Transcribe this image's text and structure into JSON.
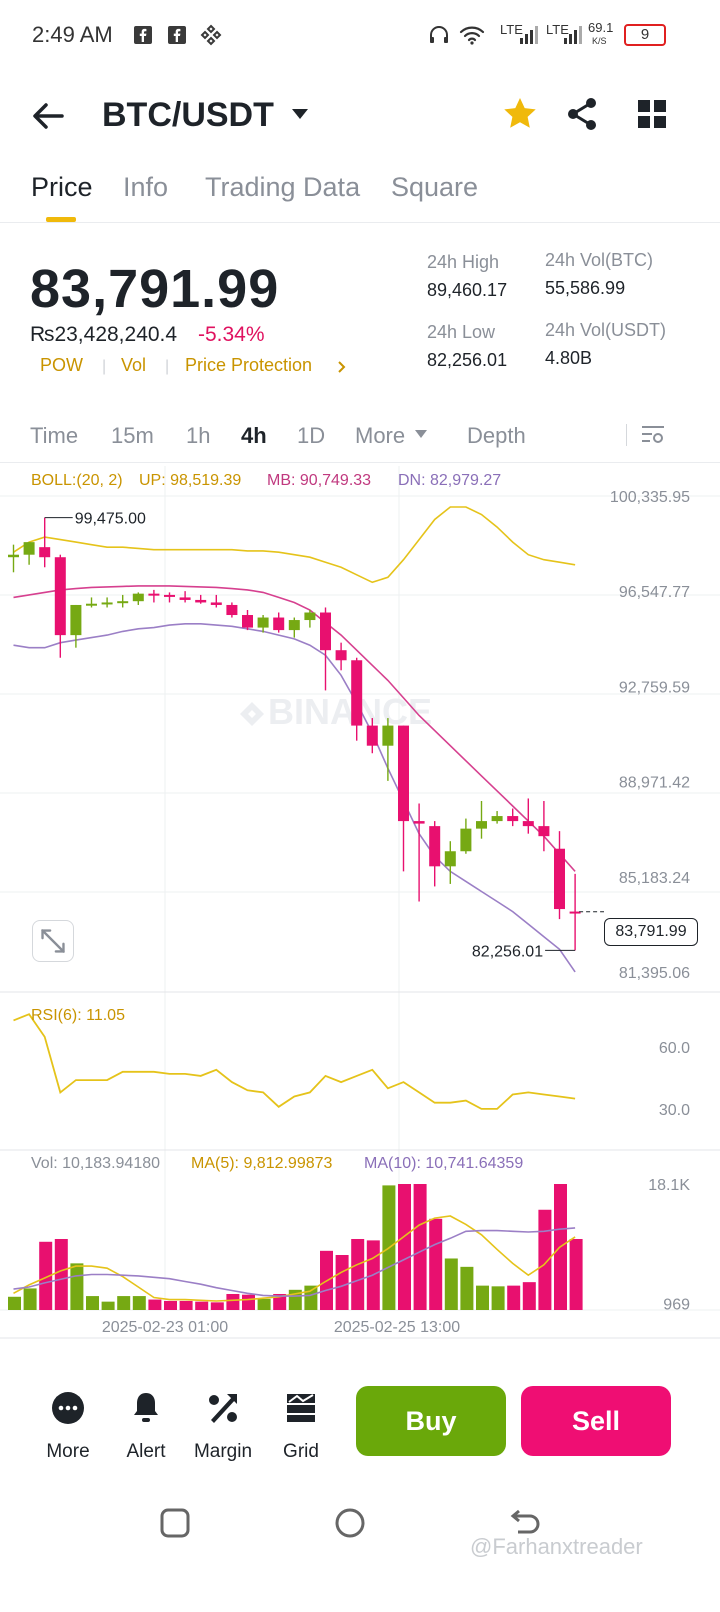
{
  "status_bar": {
    "time": "2:49 AM",
    "net_speed": "69.1",
    "net_unit": "K/S",
    "lte1": "LTE",
    "lte2": "LTE",
    "battery": "9"
  },
  "header": {
    "title": "BTC/USDT",
    "icons": [
      "back-arrow-icon",
      "dropdown-caret-icon",
      "star-icon",
      "share-icon",
      "grid-icon"
    ],
    "star_color": "#f0b90b"
  },
  "tabs": [
    "Price",
    "Info",
    "Trading Data",
    "Square"
  ],
  "active_tab": "Price",
  "ticker": {
    "last_price": "83,791.99",
    "fiat_price": "₨23,428,240.4",
    "change_pct": "-5.34%",
    "tags": [
      "POW",
      "Vol",
      "Price Protection"
    ],
    "high_label": "24h High",
    "high_value": "89,460.17",
    "low_label": "24h Low",
    "low_value": "82,256.01",
    "vol_btc_label": "24h Vol(BTC)",
    "vol_btc_value": "55,586.99",
    "vol_usdt_label": "24h Vol(USDT)",
    "vol_usdt_value": "4.80B"
  },
  "intervals": [
    "Time",
    "15m",
    "1h",
    "4h",
    "1D",
    "More",
    "Depth"
  ],
  "active_interval": "4h",
  "colors": {
    "up": "#76a913",
    "down": "#e8106f",
    "boll_up": "#e5c31a",
    "boll_mb": "#d6408f",
    "boll_dn": "#9b7fc6",
    "accent": "#f0b90b",
    "pos": "#6aa80a",
    "neg": "#ef0e73"
  },
  "chart_data": {
    "type": "candlestick",
    "boll_legend": {
      "name": "BOLL:(20, 2)",
      "up": "UP: 98,519.39",
      "mb": "MB: 90,749.33",
      "dn": "DN: 82,979.27"
    },
    "y_ticks": [
      "100,335.95",
      "96,547.77",
      "92,759.59",
      "88,971.42",
      "85,183.24",
      "81,395.06"
    ],
    "y_tick_values": [
      100335.95,
      96547.77,
      92759.59,
      88971.42,
      85183.24,
      81395.06
    ],
    "high_annotation": "99,475.00",
    "low_annotation": "82,256.01",
    "current_price_tag": "83,791.99",
    "x_ticks": [
      "2025-02-23 01:00",
      "2025-02-25 13:00"
    ],
    "watermark": "BINANCE",
    "candles": [
      [
        97900,
        98400,
        97300,
        98000
      ],
      [
        98000,
        98500,
        97600,
        98500
      ],
      [
        98300,
        99475,
        97500,
        97900
      ],
      [
        97900,
        98000,
        93900,
        94800
      ],
      [
        94800,
        96000,
        94300,
        96000
      ],
      [
        96000,
        96300,
        95900,
        96050
      ],
      [
        96050,
        96300,
        95900,
        96100
      ],
      [
        96100,
        96400,
        95900,
        96150
      ],
      [
        96150,
        96500,
        96000,
        96450
      ],
      [
        96450,
        96600,
        96100,
        96400
      ],
      [
        96400,
        96500,
        96100,
        96350
      ],
      [
        96300,
        96550,
        96100,
        96200
      ],
      [
        96200,
        96400,
        96050,
        96100
      ],
      [
        96100,
        96400,
        95900,
        96000
      ],
      [
        96000,
        96100,
        95500,
        95600
      ],
      [
        95600,
        95800,
        95000,
        95100
      ],
      [
        95100,
        95600,
        94900,
        95500
      ],
      [
        95500,
        95700,
        94900,
        95000
      ],
      [
        95000,
        95500,
        94700,
        95400
      ],
      [
        95400,
        95800,
        95100,
        95700
      ],
      [
        95700,
        95900,
        92600,
        94200
      ],
      [
        94200,
        94500,
        93400,
        93800
      ],
      [
        93800,
        93900,
        90600,
        91200
      ],
      [
        91200,
        91500,
        90100,
        90400
      ],
      [
        90400,
        91500,
        89000,
        91200
      ],
      [
        91200,
        91200,
        85400,
        87400
      ],
      [
        87400,
        88100,
        84200,
        87300
      ],
      [
        87200,
        87400,
        84800,
        85600
      ],
      [
        85600,
        86600,
        84900,
        86200
      ],
      [
        86200,
        87500,
        86100,
        87100
      ],
      [
        87100,
        88200,
        86700,
        87400
      ],
      [
        87400,
        87800,
        87300,
        87600
      ],
      [
        87600,
        87900,
        87200,
        87400
      ],
      [
        87400,
        88300,
        86900,
        87200
      ],
      [
        87200,
        88200,
        86200,
        86800
      ],
      [
        86300,
        87000,
        83500,
        83900
      ],
      [
        83800,
        85300,
        82256,
        83792
      ]
    ],
    "boll_up": [
      98100,
      98500,
      98700,
      98600,
      98500,
      98400,
      98300,
      98300,
      98250,
      98200,
      98200,
      98200,
      98200,
      98200,
      98200,
      98150,
      98150,
      98100,
      98000,
      97900,
      97700,
      97500,
      97200,
      96900,
      97100,
      97800,
      98600,
      99400,
      99900,
      99900,
      99600,
      99100,
      98500,
      98000,
      97800,
      97700,
      97600
    ],
    "boll_mb": [
      96300,
      96400,
      96500,
      96600,
      96650,
      96700,
      96720,
      96740,
      96760,
      96760,
      96760,
      96740,
      96720,
      96700,
      96650,
      96600,
      96500,
      96300,
      96100,
      95800,
      95300,
      94800,
      94200,
      93600,
      93000,
      92300,
      91600,
      91000,
      90400,
      89800,
      89200,
      88600,
      88000,
      87400,
      86800,
      86100,
      85400
    ],
    "boll_dn": [
      94400,
      94300,
      94300,
      94500,
      94600,
      94700,
      94800,
      94950,
      95050,
      95100,
      95200,
      95250,
      95250,
      95200,
      95150,
      95050,
      94950,
      94800,
      94650,
      94400,
      94000,
      93200,
      92100,
      90900,
      89500,
      88200,
      86900,
      86000,
      85400,
      85000,
      84600,
      84200,
      83800,
      83300,
      82800,
      82300,
      81400
    ]
  },
  "rsi": {
    "legend": "RSI(6): 11.05",
    "y_ticks": [
      "60.0",
      "30.0"
    ],
    "y_tick_values": [
      60,
      30
    ],
    "values": [
      73,
      76,
      65,
      38,
      44,
      44,
      44,
      48,
      48,
      48,
      47,
      47,
      46,
      49,
      43,
      39,
      38,
      31,
      36,
      38,
      46,
      43,
      46,
      49,
      40,
      43,
      38,
      33,
      33,
      34,
      30,
      30,
      37,
      38,
      37,
      36,
      35
    ]
  },
  "volume": {
    "legend_vol": "Vol: 10,183.94180",
    "legend_ma5": "MA(5): 9,812.99873",
    "legend_ma10": "MA(10): 10,741.64359",
    "y_ticks": [
      "18.1K",
      "969"
    ],
    "y_tick_values": [
      18100,
      969
    ],
    "values": [
      1900,
      3100,
      9800,
      10200,
      6700,
      2000,
      1200,
      2000,
      2000,
      1500,
      1300,
      1300,
      1200,
      1100,
      2300,
      2200,
      1600,
      2300,
      2900,
      3500,
      8500,
      7900,
      10200,
      10000,
      17900,
      18100,
      18100,
      13100,
      7400,
      6200,
      3500,
      3400,
      3500,
      4000,
      14400,
      18100,
      10200
    ],
    "ma5": [
      2400,
      3600,
      4600,
      5600,
      6300,
      6300,
      6000,
      4800,
      3300,
      1800,
      1500,
      1500,
      1400,
      1300,
      1400,
      1500,
      1700,
      1900,
      2300,
      2700,
      4100,
      5400,
      6500,
      7400,
      8800,
      10500,
      12200,
      13200,
      13500,
      12300,
      10800,
      8700,
      6700,
      5000,
      6500,
      9000,
      10500
    ],
    "ma10": [
      3000,
      3300,
      3900,
      4400,
      4900,
      5100,
      5100,
      5000,
      4900,
      4700,
      4500,
      4100,
      3700,
      3200,
      2800,
      2400,
      2100,
      2000,
      2000,
      2100,
      2800,
      3400,
      4200,
      5000,
      6100,
      7200,
      8300,
      9400,
      10300,
      11300,
      11400,
      11400,
      11300,
      11200,
      11300,
      11600,
      11800
    ]
  },
  "actions": [
    {
      "label": "More",
      "icon": "more-dots-icon"
    },
    {
      "label": "Alert",
      "icon": "bell-icon"
    },
    {
      "label": "Margin",
      "icon": "margin-percent-icon"
    },
    {
      "label": "Grid",
      "icon": "grid-bot-icon"
    }
  ],
  "buy_label": "Buy",
  "sell_label": "Sell",
  "watermark_credit": "@Farhanxtreader"
}
